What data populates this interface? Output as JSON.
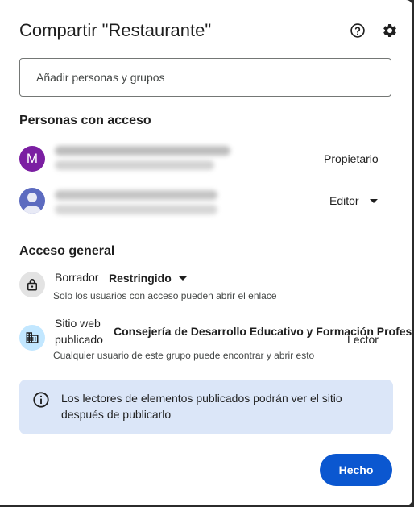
{
  "dialog": {
    "title": "Compartir \"Restaurante\"",
    "icons": [
      "help-icon",
      "settings-icon"
    ],
    "add_placeholder": "Añadir personas y grupos"
  },
  "people_section": {
    "heading": "Personas con acceso",
    "people": [
      {
        "avatar_letter": "M",
        "avatar_color": "#7b1fa2",
        "role": "Propietario"
      },
      {
        "avatar_type": "person-icon",
        "avatar_color": "#5c6bc0",
        "role": "Editor",
        "role_dropdown": true
      }
    ]
  },
  "general_access": {
    "heading": "Acceso general",
    "draft": {
      "label": "Borrador",
      "value": "Restringido",
      "description": "Solo los usuarios con acceso pueden abrir el enlace"
    },
    "published": {
      "label_line1": "Sitio web",
      "label_line2": "publicado",
      "value": "Consejería de Desarrollo Educativo y Formación Profesional",
      "role": "Lector",
      "description": "Cualquier usuario de este grupo puede encontrar y abrir esto"
    }
  },
  "info_banner": {
    "text": "Los lectores de elementos publicados podrán ver el sitio después de publicarlo"
  },
  "footer": {
    "done_label": "Hecho"
  },
  "colors": {
    "primary": "#0b57d0",
    "info_bg": "#dbe6f8",
    "text": "#1f1f1f"
  }
}
